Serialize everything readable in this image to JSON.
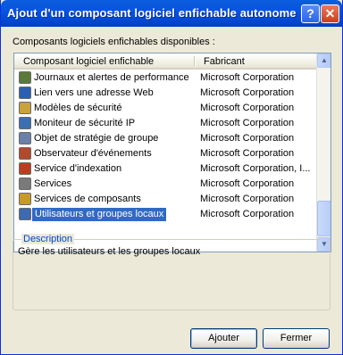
{
  "window": {
    "title": "Ajout d'un composant logiciel enfichable autonome",
    "help_label": "?",
    "close_label": "✕"
  },
  "available_label": "Composants logiciels enfichables disponibles :",
  "list": {
    "columns": [
      "Composant logiciel enfichable",
      "Fabricant"
    ],
    "rows": [
      {
        "name": "Journaux et alertes de performance",
        "vendor": "Microsoft Corporation",
        "icon": "performance-logs-icon",
        "icon_color": "#5a7a3a"
      },
      {
        "name": "Lien vers une adresse Web",
        "vendor": "Microsoft Corporation",
        "icon": "web-link-icon",
        "icon_color": "#2c5fb3"
      },
      {
        "name": "Modèles de sécurité",
        "vendor": "Microsoft Corporation",
        "icon": "security-templates-icon",
        "icon_color": "#c8a23a"
      },
      {
        "name": "Moniteur de sécurité IP",
        "vendor": "Microsoft Corporation",
        "icon": "ip-security-monitor-icon",
        "icon_color": "#3a6fb0"
      },
      {
        "name": "Objet de stratégie de groupe",
        "vendor": "Microsoft Corporation",
        "icon": "group-policy-icon",
        "icon_color": "#6b7fa8"
      },
      {
        "name": "Observateur d'événements",
        "vendor": "Microsoft Corporation",
        "icon": "event-viewer-icon",
        "icon_color": "#b04a2a"
      },
      {
        "name": "Service d'indexation",
        "vendor": "Microsoft Corporation, I...",
        "icon": "indexing-service-icon",
        "icon_color": "#b8401e"
      },
      {
        "name": "Services",
        "vendor": "Microsoft Corporation",
        "icon": "services-icon",
        "icon_color": "#7a7a7a"
      },
      {
        "name": "Services de composants",
        "vendor": "Microsoft Corporation",
        "icon": "component-services-icon",
        "icon_color": "#c79a28"
      },
      {
        "name": "Utilisateurs et groupes locaux",
        "vendor": "Microsoft Corporation",
        "icon": "local-users-groups-icon",
        "icon_color": "#3e6ab0",
        "selected": true
      }
    ]
  },
  "description": {
    "title": "Description",
    "text": "Gère les utilisateurs et les groupes locaux"
  },
  "buttons": {
    "add": "Ajouter",
    "close": "Fermer"
  }
}
